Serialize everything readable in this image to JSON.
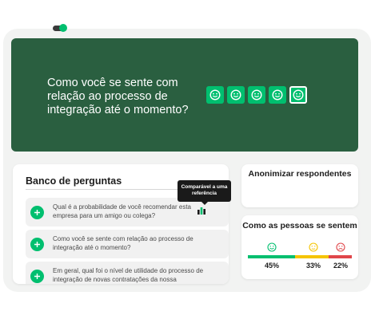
{
  "hero": {
    "question": "Como você se sente com relação ao processo de integração até o momento?",
    "face_icons": [
      "smile-face-icon",
      "smile-face-icon",
      "smile-face-icon",
      "smile-face-icon",
      "smile-face-icon"
    ],
    "color_bg": "#2a5f40",
    "color_accent": "#00bf6f"
  },
  "bank": {
    "title": "Banco de perguntas",
    "items": [
      {
        "text": "Qual é a probabilidade de você recomendar esta empresa para um amigo ou colega?"
      },
      {
        "text": "Como você se sente com relação ao processo de integração até o momento?"
      },
      {
        "text": "Em geral, qual foi o nível de utilidade do processo de integração de novas contratações da nossa"
      }
    ],
    "tooltip": "Comparável a uma referência"
  },
  "anon": {
    "title": "Anonimizar respondentes",
    "toggle_on": true
  },
  "sentiment": {
    "title": "Como as pessoas se sentem",
    "segments": [
      {
        "label": "45%",
        "value": 45,
        "icon": "happy-face-icon",
        "color": "#00bf6f"
      },
      {
        "label": "33%",
        "value": 33,
        "icon": "neutral-face-icon",
        "color": "#f5c400"
      },
      {
        "label": "22%",
        "value": 22,
        "icon": "sad-face-icon",
        "color": "#e0464a"
      }
    ]
  }
}
